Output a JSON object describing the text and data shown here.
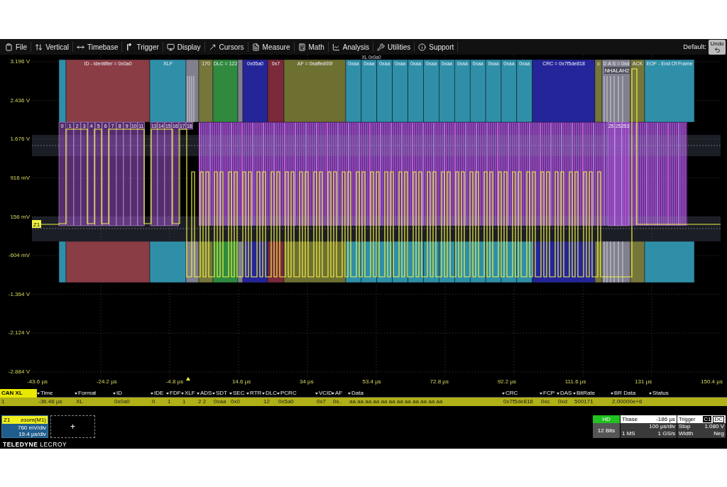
{
  "menu": [
    "File",
    "Vertical",
    "Timebase",
    "Trigger",
    "Display",
    "Cursors",
    "Measure",
    "Math",
    "Analysis",
    "Utilities",
    "Support"
  ],
  "preset": {
    "label": "Default:",
    "undo": "Undo"
  },
  "y_axis": [
    "3.196 V",
    "2.436 V",
    "1.676 V",
    "916 mV",
    "156 mV",
    "-604 mV",
    "-1.364 V",
    "-2.124 V",
    "-2.884 V"
  ],
  "trace_tag": "Z1",
  "x_axis": [
    "-43.6 µs",
    "-24.2 µs",
    "-4.8 µs",
    "14.6 µs",
    "34 µs",
    "53.4 µs",
    "72.8 µs",
    "92.2 µs",
    "111.6 µs",
    "131 µs",
    "150.4 µs"
  ],
  "decode": {
    "header_label": "XL 0x0a0",
    "sub_label": "NHALAH2",
    "fields": [
      {
        "color": "#2f8fa8"
      },
      {
        "label": "ID - Identifier = 0x0a0",
        "color": "#8a3d45"
      },
      {
        "label": "XLF",
        "color": "#2f8fa8"
      },
      {
        "color": "#80808e"
      },
      {
        "label": "170",
        "color": "#75773a"
      },
      {
        "label": "DLC = 122",
        "color": "#2f8a3e"
      },
      {
        "color": "#80808e"
      },
      {
        "label": "0x05a0",
        "color": "#25259a"
      },
      {
        "label": "0x7",
        "color": "#7a2a3a"
      },
      {
        "label": "AF = 0xaffed00f",
        "color": "#6e7032"
      },
      {
        "label": "0xaa",
        "color": "#2f8fa8"
      },
      {
        "label": "0xaa",
        "color": "#2f8fa8"
      },
      {
        "label": "0xaa",
        "color": "#2f8fa8"
      },
      {
        "label": "0xaa",
        "color": "#2f8fa8"
      },
      {
        "label": "0xaa",
        "color": "#2f8fa8"
      },
      {
        "label": "0xaa",
        "color": "#2f8fa8"
      },
      {
        "label": "0xaa",
        "color": "#2f8fa8"
      },
      {
        "label": "0xaa",
        "color": "#2f8fa8"
      },
      {
        "label": "0xaa",
        "color": "#2f8fa8"
      },
      {
        "label": "0xaa",
        "color": "#2f8fa8"
      },
      {
        "label": "0xaa",
        "color": "#2f8fa8"
      },
      {
        "label": "0xaa",
        "color": "#2f8fa8"
      },
      {
        "label": "CRC = 0x7f5de818",
        "color": "#25259a"
      },
      {
        "label": "c",
        "color": "#75773a"
      },
      {
        "label": "D A S = 0xd",
        "color": "#80808e"
      },
      {
        "label": "ACK",
        "color": "#75773a"
      },
      {
        "label": "EOF - End Of Frame",
        "color": "#2f8fa8"
      }
    ],
    "bits": [
      "0",
      "1",
      "2",
      "3",
      "4",
      "5",
      "6",
      "7",
      "8",
      "9",
      "10",
      "11",
      "13",
      "14",
      "15",
      "16",
      "17",
      "18",
      "25",
      "25",
      "253"
    ]
  },
  "table": {
    "columns": [
      "CAN XL",
      "Time",
      "Format",
      "ID",
      "IDE",
      "FDF",
      "XLF",
      "ADS",
      "SDT",
      "SEC",
      "RTR",
      "DLC",
      "PCRC",
      "VCID",
      "AF",
      "Data",
      "CRC",
      "FCP",
      "DAS",
      "BitRate",
      "BR Data",
      "Status"
    ],
    "rows": [
      {
        "cells": [
          "1",
          "-36.46 µs",
          "XL",
          "0x0a0",
          "0",
          "1",
          "1",
          "2 2",
          "0xaa",
          "0x0",
          null,
          "12",
          "0x5a0",
          "0x7",
          "0x..",
          "aa aa aa aa aa aa aa aa aa aa aa aa",
          "0x7f5de818",
          "0xc",
          "0xd",
          "500171",
          "2.00000e+6",
          null
        ]
      }
    ]
  },
  "zoom_panel": {
    "name": "Z1",
    "title": "zoom(M1)",
    "vdiv": "760 mV/div",
    "hdiv": "19.4 µs/div"
  },
  "add_label": "+",
  "acquisition": {
    "badge": "HD",
    "bits": "12 Bits"
  },
  "timebase": {
    "title": "Tbase",
    "delay": "-186 µs",
    "tdiv": "100 µs/div",
    "memory": "1 MS",
    "rate": "1 GS/s"
  },
  "trigger": {
    "title": "Trigger",
    "source": "C1",
    "coupling": "DC",
    "mode": "Stop",
    "level": "1.080 V",
    "type": "Width",
    "slope": "Neg"
  },
  "brand": "**TELEDYNE** LECROY"
}
